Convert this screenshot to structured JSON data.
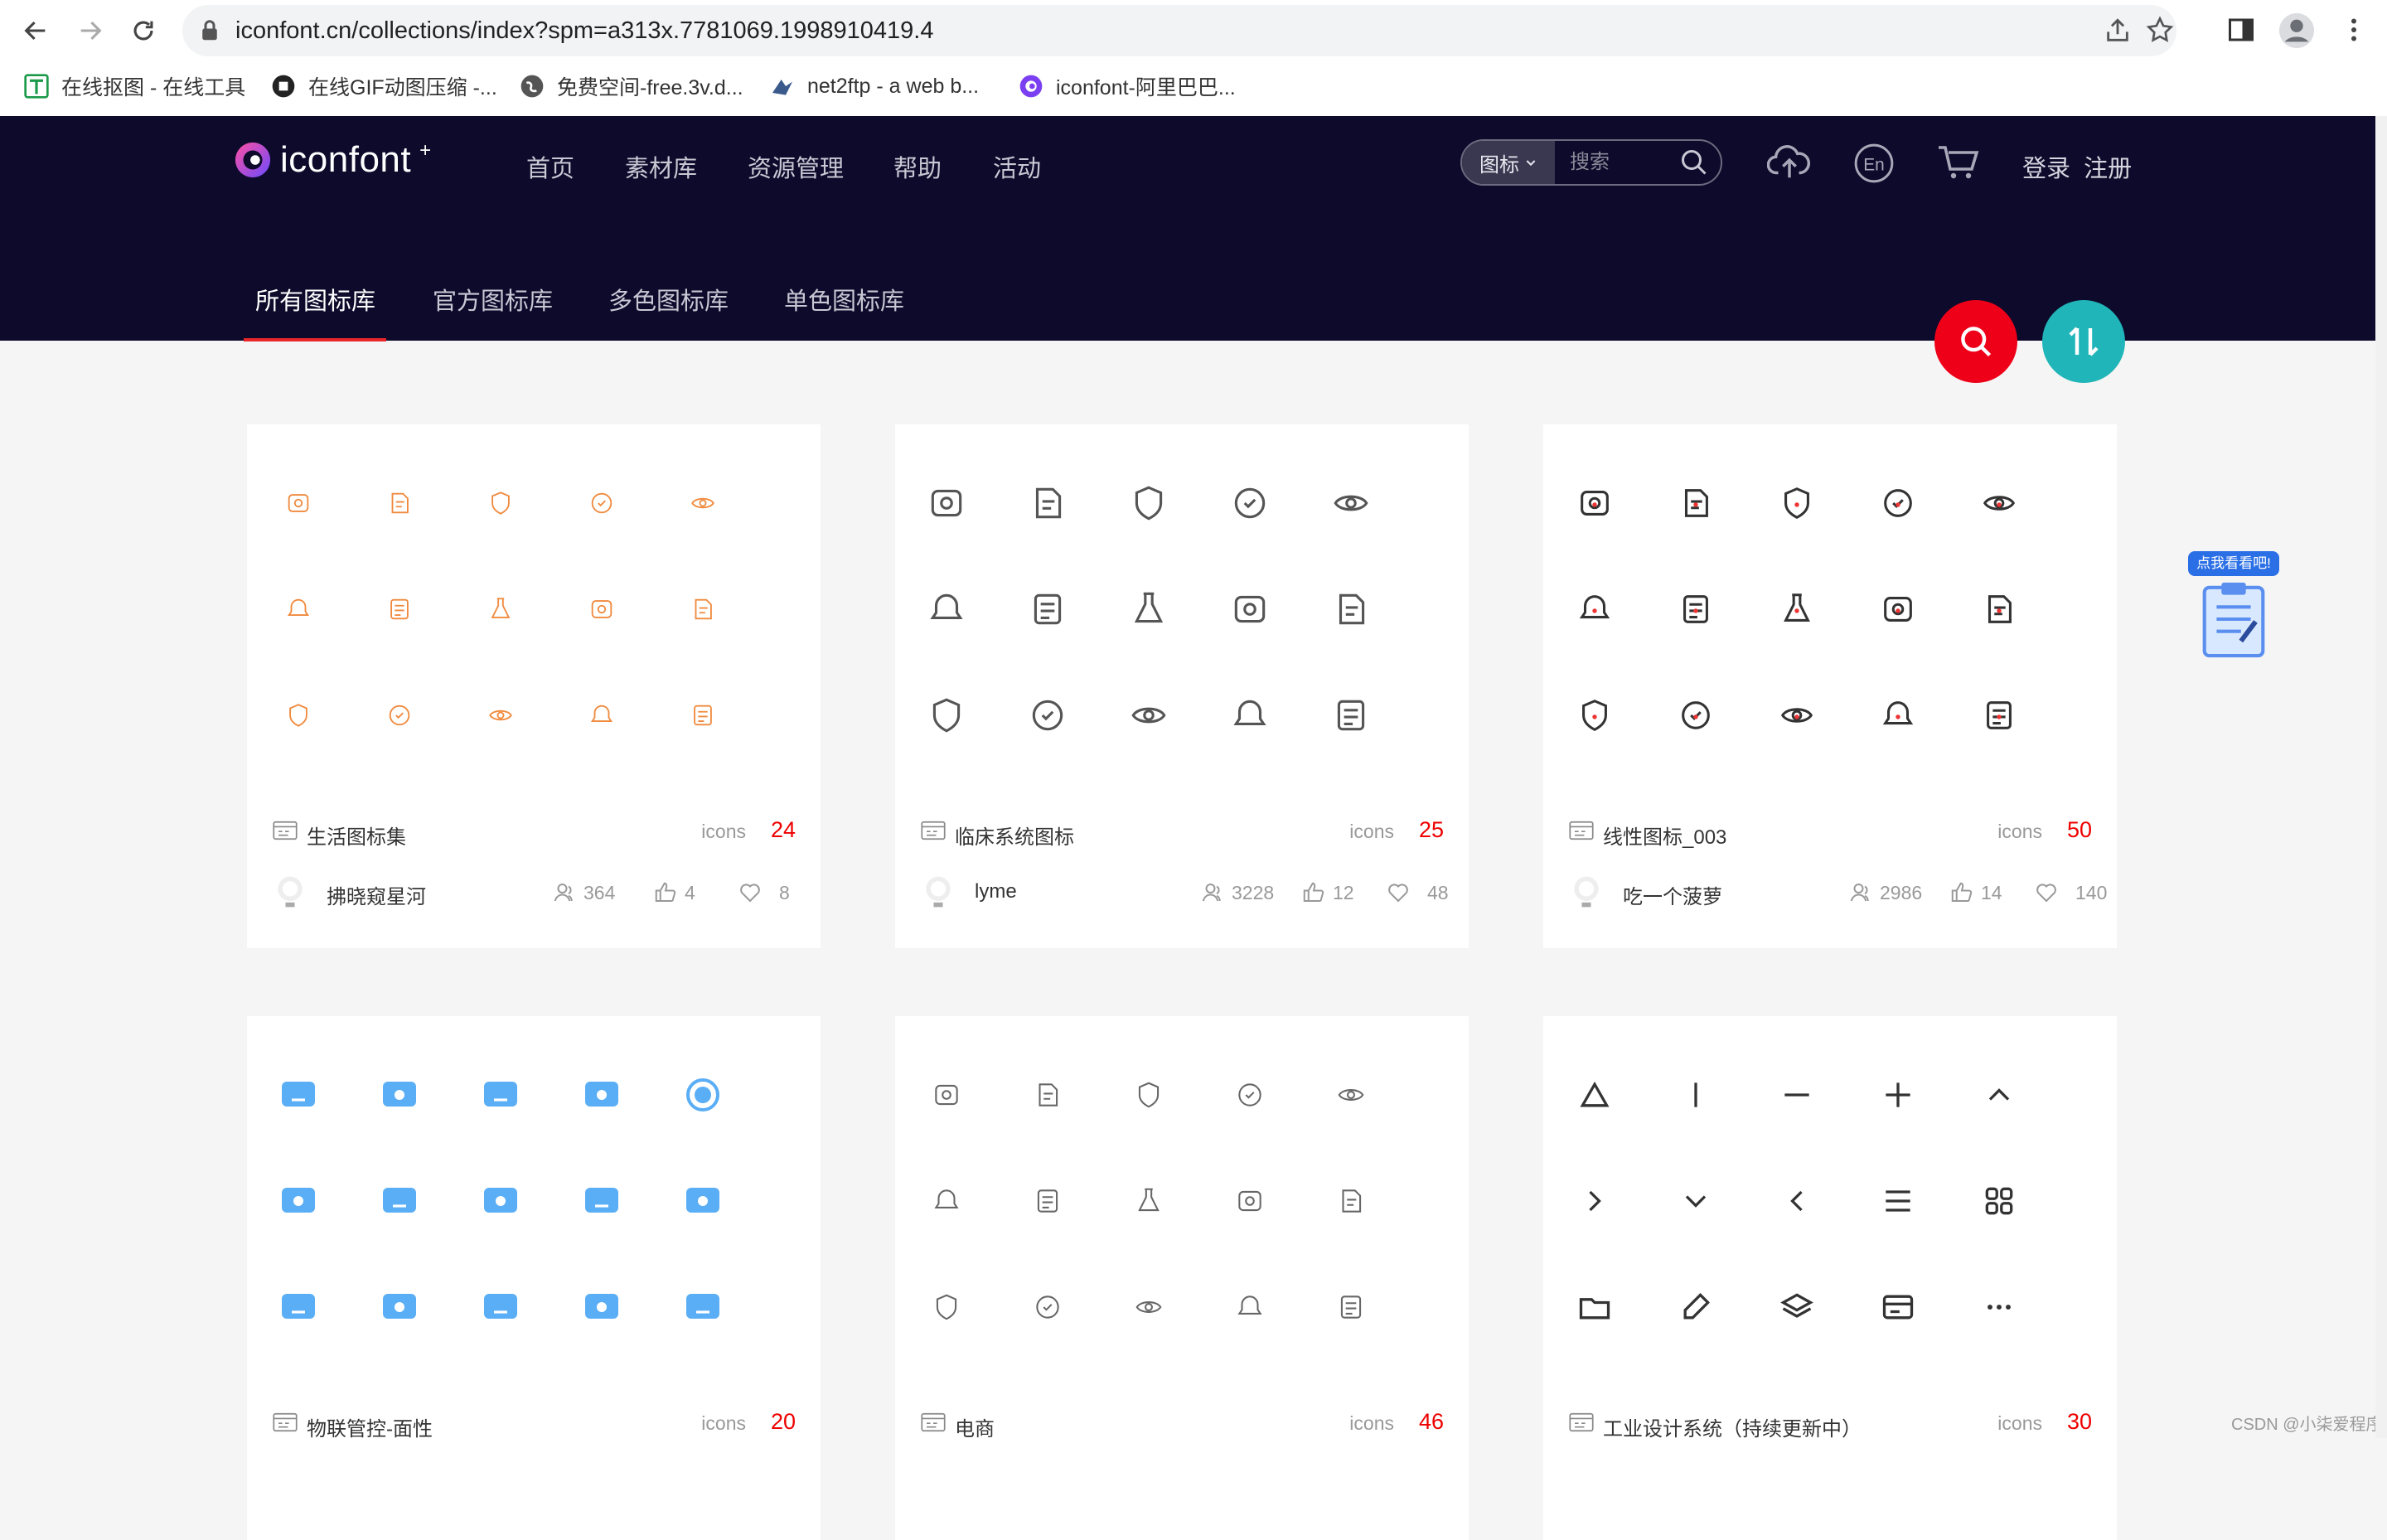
{
  "browser": {
    "url": "iconfont.cn/collections/index?spm=a313x.7781069.1998910419.4",
    "bookmarks": [
      {
        "label": "在线抠图 - 在线工具",
        "icon": "green-doc-icon"
      },
      {
        "label": "在线GIF动图压缩 -...",
        "icon": "black-circle-icon"
      },
      {
        "label": "免费空间-free.3v.d...",
        "icon": "globe-icon"
      },
      {
        "label": "net2ftp - a web b...",
        "icon": "ftp-icon"
      },
      {
        "label": "iconfont-阿里巴巴...",
        "icon": "iconfont-icon"
      }
    ]
  },
  "site": {
    "logo_text": "iconfont",
    "nav": [
      "首页",
      "素材库",
      "资源管理",
      "帮助",
      "活动"
    ],
    "search": {
      "type": "图标",
      "placeholder": "搜索"
    },
    "lang": "En",
    "login": "登录",
    "register": "注册",
    "subtabs": [
      "所有图标库",
      "官方图标库",
      "多色图标库",
      "单色图标库"
    ],
    "promo_badge": "点我看看吧!",
    "watermark": "CSDN @小柒爱程序"
  },
  "cards": [
    {
      "title": "生活图标集",
      "icons_label": "icons",
      "count": "24",
      "author": "拂晓窥星河",
      "users": "364",
      "likes": "4",
      "favs": "8",
      "style": "orange"
    },
    {
      "title": "临床系统图标",
      "icons_label": "icons",
      "count": "25",
      "author": "lyme",
      "users": "3228",
      "likes": "12",
      "favs": "48",
      "style": "gray"
    },
    {
      "title": "线性图标_003",
      "icons_label": "icons",
      "count": "50",
      "author": "吃一个菠萝",
      "users": "2986",
      "likes": "14",
      "favs": "140",
      "style": "dark-red"
    },
    {
      "title": "物联管控-面性",
      "icons_label": "icons",
      "count": "20",
      "author": "",
      "users": "",
      "likes": "",
      "favs": "",
      "style": "blue"
    },
    {
      "title": "电商",
      "icons_label": "icons",
      "count": "46",
      "author": "",
      "users": "",
      "likes": "",
      "favs": "",
      "style": "gray-thin"
    },
    {
      "title": "工业设计系统（持续更新中）",
      "icons_label": "icons",
      "count": "30",
      "author": "",
      "users": "",
      "likes": "",
      "favs": "",
      "style": "dark"
    }
  ],
  "colors": {
    "header_bg": "#0d0a2b",
    "accent_red": "#e8262a",
    "fab_search": "#ef0019",
    "fab_sort": "#20b5b8",
    "count_red": "#ee0000",
    "icon_orange": "#f08a3e",
    "icon_blue": "#4a9ff0"
  }
}
